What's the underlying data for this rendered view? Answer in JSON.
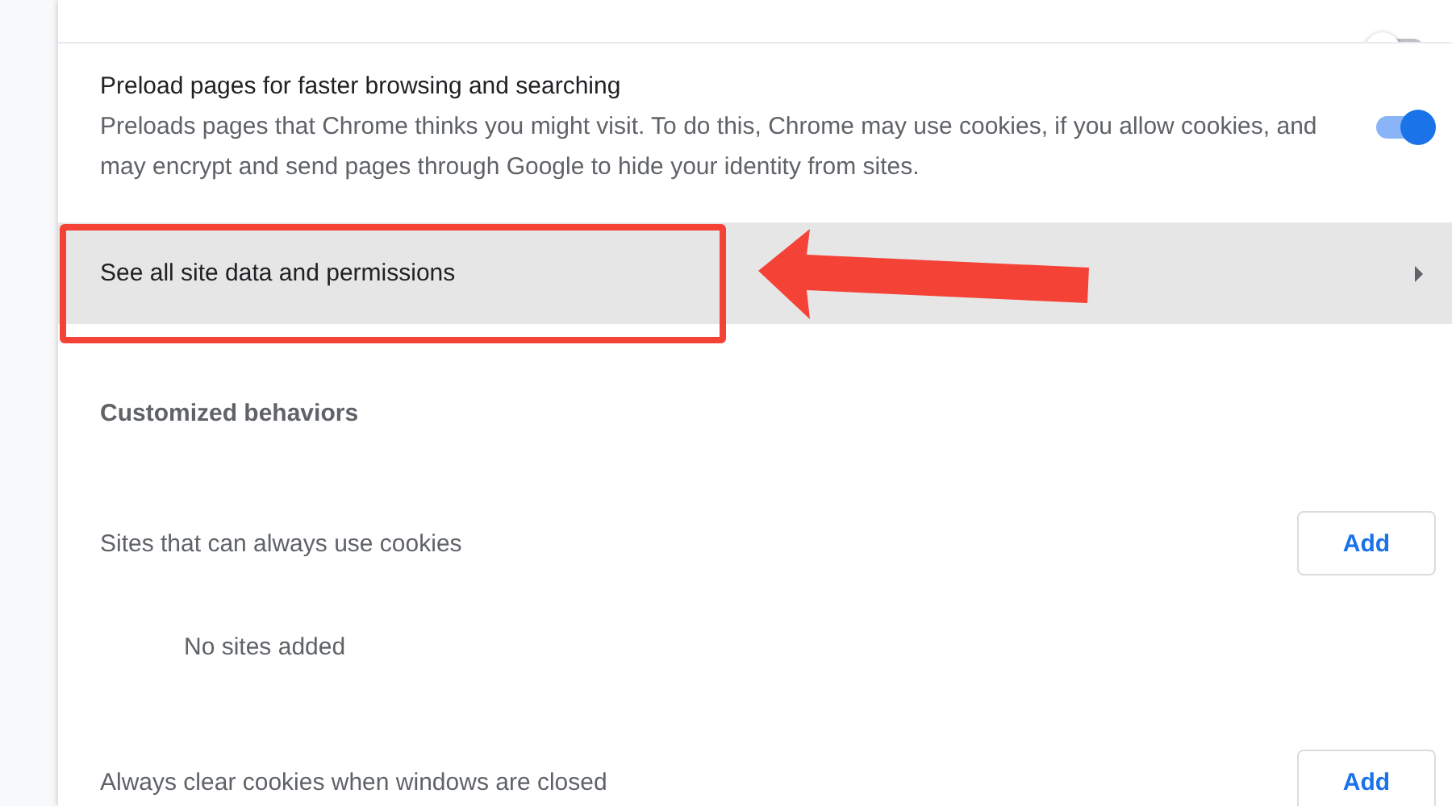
{
  "settings": [
    {
      "kind": "toggle",
      "on": false
    },
    {
      "kind": "toggle",
      "title": "Preload pages for faster browsing and searching",
      "description": "Preloads pages that Chrome thinks you might visit. To do this, Chrome may use cookies, if you allow cookies, and may encrypt and send pages through Google to hide your identity from sites.",
      "on": true
    },
    {
      "kind": "link",
      "label": "See all site data and permissions",
      "highlighted": true
    }
  ],
  "section": {
    "title": "Customized behaviors"
  },
  "lists": [
    {
      "label": "Sites that can always use cookies",
      "button": "Add",
      "empty_text": "No sites added"
    },
    {
      "label": "Always clear cookies when windows are closed",
      "button": "Add"
    }
  ]
}
